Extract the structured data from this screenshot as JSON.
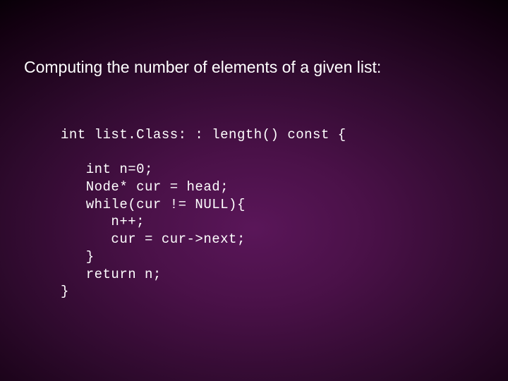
{
  "slide": {
    "title": "Computing the number of elements of a given list:",
    "code": "int list.Class: : length() const {\n\n   int n=0;\n   Node* cur = head;\n   while(cur != NULL){\n      n++;\n      cur = cur->next;\n   }\n   return n;\n}"
  }
}
